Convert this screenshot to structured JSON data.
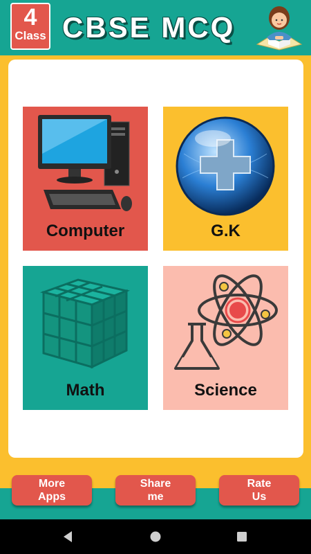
{
  "header": {
    "class_number": "4",
    "class_label": "Class",
    "title": "CBSE MCQ",
    "student_icon": "student-reading-icon"
  },
  "categories": [
    {
      "label": "Computer",
      "icon": "computer-icon",
      "color": "#e2574c"
    },
    {
      "label": "G.K",
      "icon": "globe-plus-icon",
      "color": "#fbbf2e"
    },
    {
      "label": "Math",
      "icon": "cube-icon",
      "color": "#16a593"
    },
    {
      "label": "Science",
      "icon": "atom-flask-icon",
      "color": "#fbbcae"
    }
  ],
  "buttons": {
    "more_apps": "More\nApps",
    "share_me": "Share\nme",
    "rate_us": "Rate\nUs"
  },
  "colors": {
    "teal": "#16a593",
    "yellow": "#fbbf2e",
    "red": "#e2574c",
    "peach": "#fbbcae"
  }
}
